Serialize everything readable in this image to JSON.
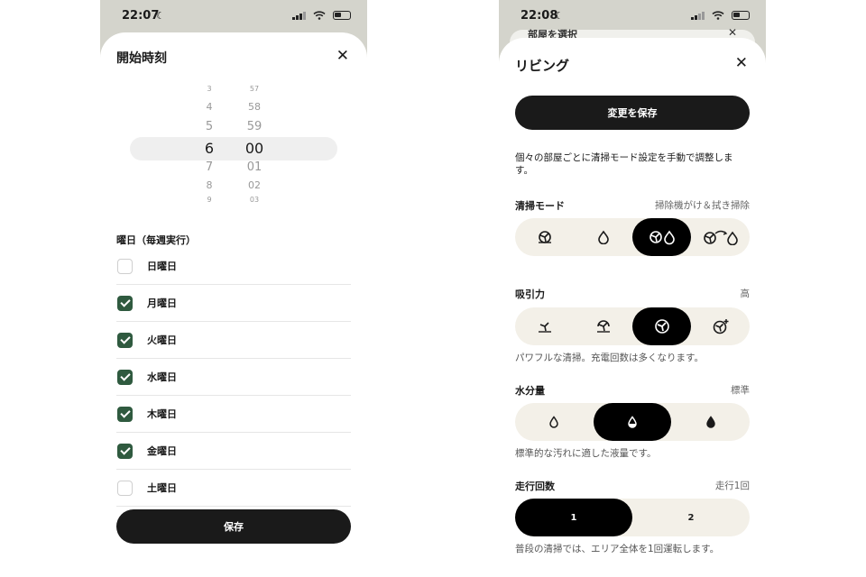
{
  "left": {
    "status": {
      "time": "22:07"
    },
    "title": "開始時刻",
    "picker": {
      "hours": [
        "3",
        "4",
        "5",
        "6",
        "7",
        "8",
        "9"
      ],
      "minutes": [
        "57",
        "58",
        "59",
        "00",
        "01",
        "02",
        "03"
      ],
      "selected_hour": "6",
      "selected_minute": "00"
    },
    "weekday_label": "曜日（毎週実行）",
    "days": [
      {
        "label": "日曜日",
        "checked": false
      },
      {
        "label": "月曜日",
        "checked": true
      },
      {
        "label": "火曜日",
        "checked": true
      },
      {
        "label": "水曜日",
        "checked": true
      },
      {
        "label": "木曜日",
        "checked": true
      },
      {
        "label": "金曜日",
        "checked": true
      },
      {
        "label": "土曜日",
        "checked": false
      }
    ],
    "save_label": "保存"
  },
  "right": {
    "status": {
      "time": "22:08"
    },
    "back_sheet_title": "部屋を選択",
    "title": "リビング",
    "save_label": "変更を保存",
    "description": "個々の部屋ごとに清掃モード設定を手動で調整します。",
    "cleaning_mode": {
      "label": "清掃モード",
      "value": "掃除機がけ＆拭き掃除",
      "options": [
        "vacuum-icon",
        "mop-drop-icon",
        "vacuum-and-mop-icon",
        "vacuum-then-mop-icon"
      ],
      "selected": 2
    },
    "suction": {
      "label": "吸引力",
      "value": "高",
      "options": [
        "fan-quiet-icon",
        "fan-standard-icon",
        "fan-strong-icon",
        "fan-max-icon"
      ],
      "selected": 2,
      "hint": "パワフルな清掃。充電回数は多くなります。"
    },
    "water": {
      "label": "水分量",
      "value": "標準",
      "options": [
        "drop-low-icon",
        "drop-medium-icon",
        "drop-high-icon"
      ],
      "selected": 1,
      "hint": "標準的な汚れに適した液量です。"
    },
    "passes": {
      "label": "走行回数",
      "value": "走行1回",
      "options": [
        "1",
        "2"
      ],
      "selected": 0,
      "hint": "普段の清掃では、エリア全体を1回運転します。"
    }
  }
}
